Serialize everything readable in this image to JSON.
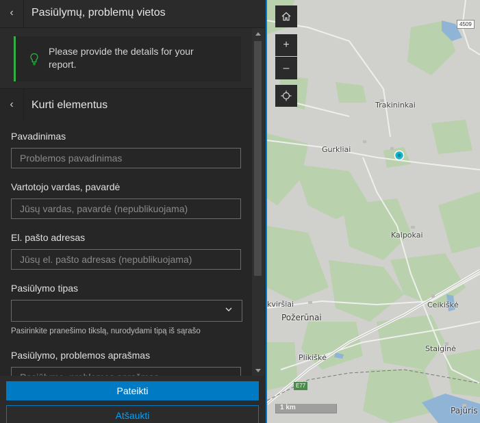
{
  "panel": {
    "header": {
      "title": "Pasiūlymų, problemų vietos",
      "back_icon": "chevron-left-icon"
    },
    "notice": {
      "text": "Please provide the details for your report.",
      "icon": "lightbulb-icon",
      "accent": "#35ac46"
    },
    "subheader": {
      "title": "Kurti elementus",
      "back_icon": "chevron-left-icon"
    },
    "form": {
      "name": {
        "label": "Pavadinimas",
        "placeholder": "Problemos pavadinimas",
        "value": ""
      },
      "user": {
        "label": "Vartotojo vardas, pavardė",
        "placeholder": "Jūsų vardas, pavardė (nepublikuojama)",
        "value": ""
      },
      "email": {
        "label": "El. pašto adresas",
        "placeholder": "Jūsų el. pašto adresas (nepublikuojama)",
        "value": ""
      },
      "type": {
        "label": "Pasiūlymo tipas",
        "value": "",
        "hint": "Pasirinkite pranešimo tikslą, nurodydami tipą iš sąrašo"
      },
      "description": {
        "label": "Pasiūlymo, problemos aprašmas",
        "placeholder": "Pasiūlymo, problemos aprašmas"
      }
    },
    "footer": {
      "submit_label": "Pateikti",
      "cancel_label": "Atšaukti"
    }
  },
  "map": {
    "controls": {
      "home_icon": "home-icon",
      "zoom_in": "+",
      "zoom_out": "–",
      "locate_icon": "locate-icon"
    },
    "places": {
      "trakininkai": "Trakininkai",
      "gurkliai": "Gurkliai",
      "kalpokai": "Kalpokai",
      "kvirsiai": "kviršiai",
      "pozerunai": "Požerūnai",
      "ceikiske": "Ceikiškė",
      "staigine": "Staiginė",
      "plikiske": "Plikiškė",
      "pajuris": "Pajūris"
    },
    "route_4509": "4509",
    "route_e77": "E77",
    "scale": "1 km",
    "marker_color": "#1ab4c8"
  },
  "colors": {
    "accent": "#007ac2",
    "panel_bg": "#2b2b2b"
  }
}
